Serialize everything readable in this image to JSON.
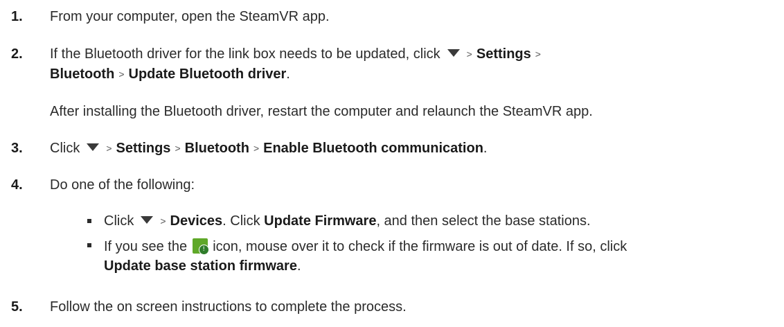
{
  "steps": [
    {
      "number": "1.",
      "text": "From your computer, open the SteamVR app."
    },
    {
      "number": "2.",
      "pre": "If the Bluetooth driver for the link box needs to be updated, click",
      "sep1": ">",
      "settings": "Settings",
      "sep2": ">",
      "bluetooth": "Bluetooth",
      "sep3": ">",
      "update_driver": "Update Bluetooth driver",
      "period": ".",
      "note": "After installing the Bluetooth driver, restart the computer and relaunch the SteamVR app."
    },
    {
      "number": "3.",
      "pre": "Click",
      "sep1": ">",
      "settings": "Settings",
      "sep2": ">",
      "bluetooth": "Bluetooth",
      "sep3": ">",
      "enable": "Enable Bluetooth communication",
      "period": "."
    },
    {
      "number": "4.",
      "text": "Do one of the following:",
      "bullets": [
        {
          "pre": "Click",
          "sep": ">",
          "devices": "Devices",
          "mid": ". Click",
          "update_firmware": "Update Firmware",
          "post": ", and then select the base stations."
        },
        {
          "pre": "If you see the",
          "icon_name": "base-station-update-icon",
          "icon_badge": "!",
          "post": "icon, mouse over it to check if the firmware is out of date. If so, click",
          "action": "Update base station firmware",
          "period": "."
        }
      ]
    },
    {
      "number": "5.",
      "text": "Follow the on screen instructions to complete the process."
    }
  ]
}
